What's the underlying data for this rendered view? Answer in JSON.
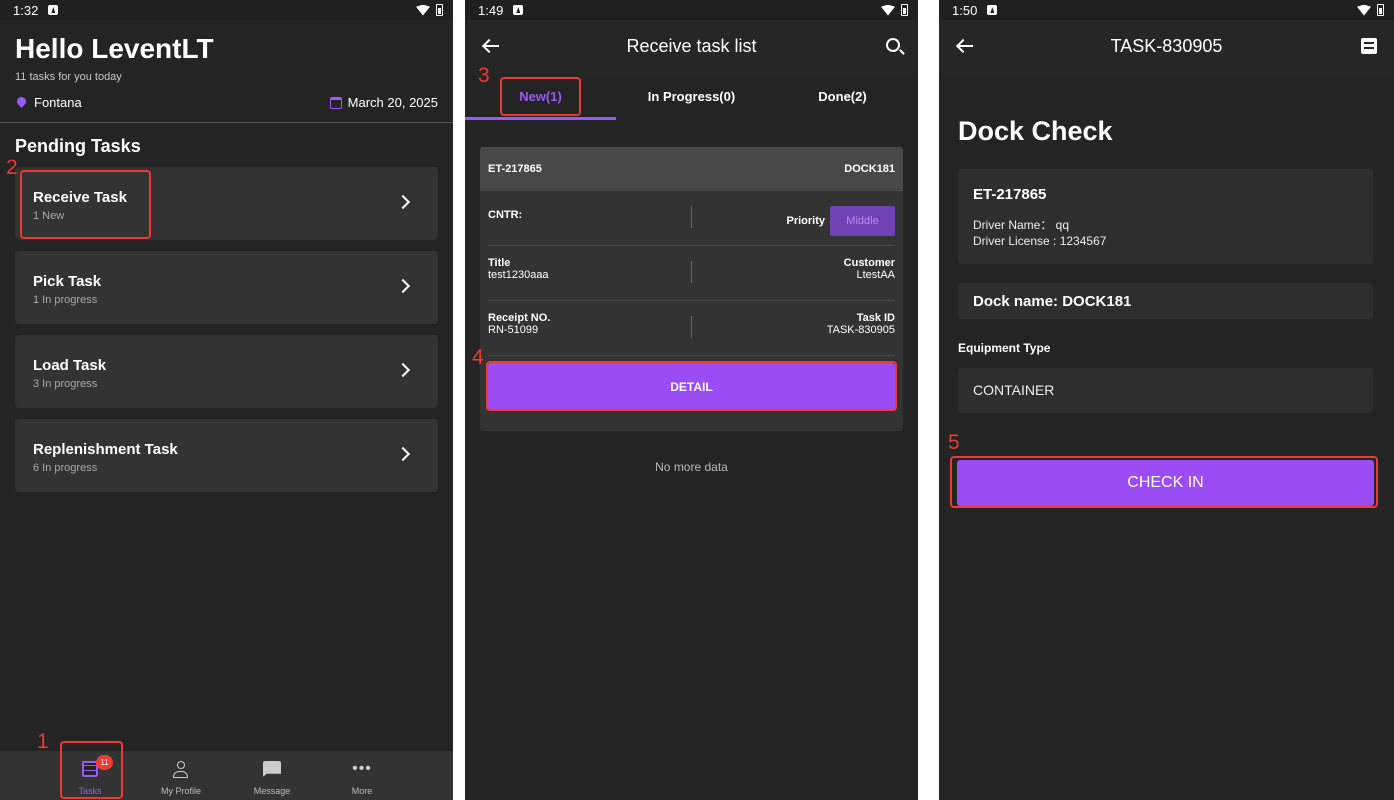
{
  "screen1": {
    "status_time": "1:32",
    "greeting": "Hello LeventLT",
    "subtitle": "11 tasks for you today",
    "location": "Fontana",
    "date": "March 20, 2025",
    "section_title": "Pending Tasks",
    "tasks": [
      {
        "name": "Receive Task",
        "status": "1 New"
      },
      {
        "name": "Pick Task",
        "status": "1 In progress"
      },
      {
        "name": "Load Task",
        "status": "3 In progress"
      },
      {
        "name": "Replenishment Task",
        "status": "6 In progress"
      }
    ],
    "nav": [
      {
        "label": "Tasks",
        "icon": "list-icon",
        "badge": "11"
      },
      {
        "label": "My Profile",
        "icon": "person-icon"
      },
      {
        "label": "Message",
        "icon": "message-icon"
      },
      {
        "label": "More",
        "icon": "more-icon"
      }
    ]
  },
  "screen2": {
    "status_time": "1:49",
    "title": "Receive task list",
    "tabs": [
      "New(1)",
      "In Progress(0)",
      "Done(2)"
    ],
    "card": {
      "entry_id": "ET-217865",
      "dock": "DOCK181",
      "cntr_label": "CNTR:",
      "priority_label": "Priority",
      "priority_value": "Middle",
      "title_label": "Title",
      "title_value": "test1230aaa",
      "customer_label": "Customer",
      "customer_value": "LtestAA",
      "receipt_label": "Receipt NO.",
      "receipt_value": "RN-51099",
      "taskid_label": "Task ID",
      "taskid_value": "TASK-830905",
      "detail_button": "DETAIL"
    },
    "no_more": "No more data"
  },
  "screen3": {
    "status_time": "1:50",
    "title": "TASK-830905",
    "heading": "Dock Check",
    "entry_id": "ET-217865",
    "driver_name": "Driver Name：  qq",
    "driver_license": "Driver License : 1234567",
    "dock_name": "Dock name: DOCK181",
    "equipment_label": "Equipment Type",
    "equipment_value": "CONTAINER",
    "checkin_button": "CHECK IN"
  },
  "annotations": [
    "1",
    "2",
    "3",
    "4",
    "5"
  ],
  "colors": {
    "accent": "#9b4cf5",
    "highlight": "#ee3a33",
    "background": "#242424"
  }
}
